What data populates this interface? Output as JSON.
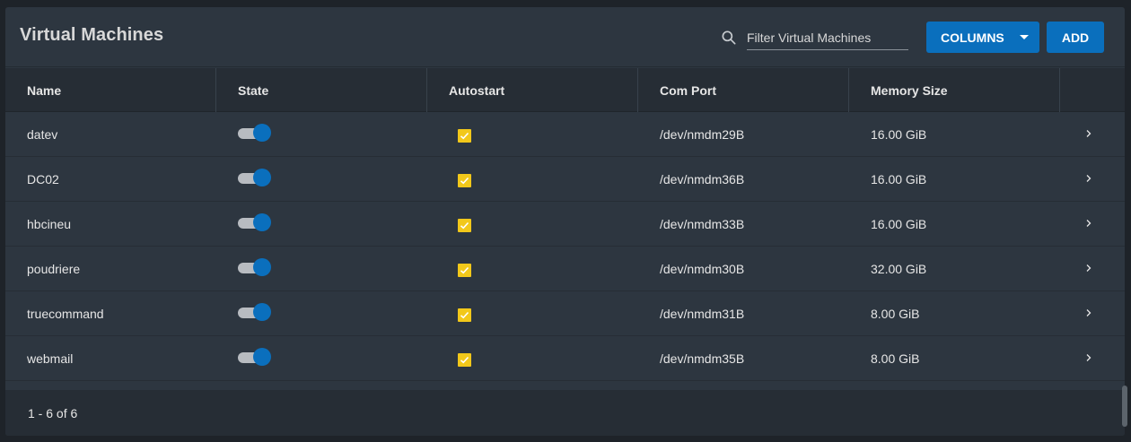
{
  "header": {
    "title": "Virtual Machines",
    "search_placeholder": "Filter Virtual Machines",
    "search_value": "",
    "columns_label": "COLUMNS",
    "add_label": "ADD"
  },
  "table": {
    "columns": [
      "Name",
      "State",
      "Autostart",
      "Com Port",
      "Memory Size"
    ],
    "rows": [
      {
        "name": "datev",
        "state_on": true,
        "autostart": true,
        "com_port": "/dev/nmdm29B",
        "memory": "16.00 GiB"
      },
      {
        "name": "DC02",
        "state_on": true,
        "autostart": true,
        "com_port": "/dev/nmdm36B",
        "memory": "16.00 GiB"
      },
      {
        "name": "hbcineu",
        "state_on": true,
        "autostart": true,
        "com_port": "/dev/nmdm33B",
        "memory": "16.00 GiB"
      },
      {
        "name": "poudriere",
        "state_on": true,
        "autostart": true,
        "com_port": "/dev/nmdm30B",
        "memory": "32.00 GiB"
      },
      {
        "name": "truecommand",
        "state_on": true,
        "autostart": true,
        "com_port": "/dev/nmdm31B",
        "memory": "8.00 GiB"
      },
      {
        "name": "webmail",
        "state_on": true,
        "autostart": true,
        "com_port": "/dev/nmdm35B",
        "memory": "8.00 GiB"
      }
    ]
  },
  "footer": {
    "paginator": "1 - 6 of 6"
  },
  "colors": {
    "accent": "#0a6fbd",
    "checkbox": "#f2c81a",
    "card_bg": "#2d3640",
    "header_row_bg": "#262d35"
  },
  "icons": {
    "search": "search-icon",
    "dropdown": "caret-down-icon",
    "row_expand": "chevron-right-icon"
  }
}
